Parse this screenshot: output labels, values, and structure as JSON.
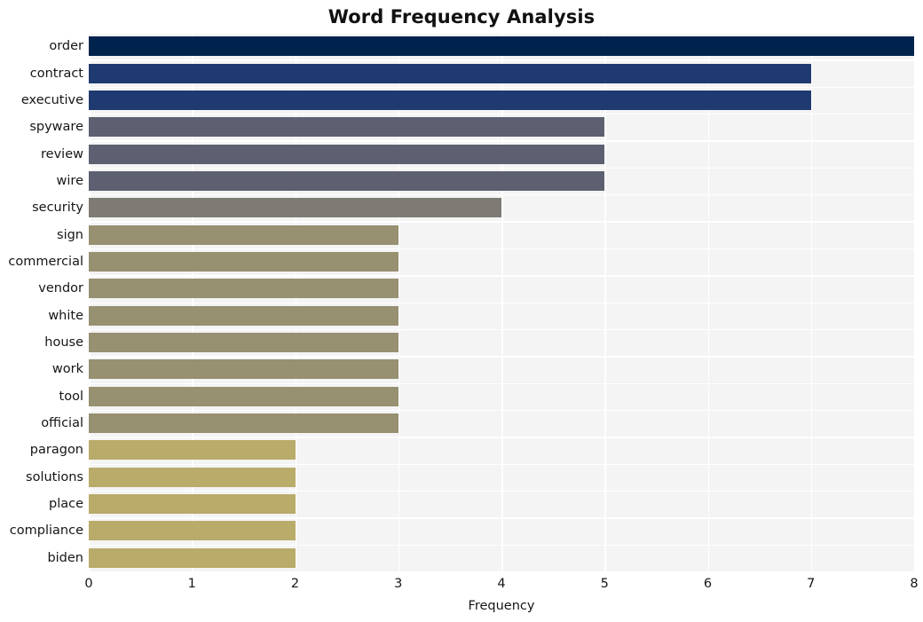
{
  "chart_data": {
    "type": "bar",
    "orientation": "horizontal",
    "title": "Word Frequency Analysis",
    "xlabel": "Frequency",
    "ylabel": "",
    "categories": [
      "order",
      "contract",
      "executive",
      "spyware",
      "review",
      "wire",
      "security",
      "sign",
      "commercial",
      "vendor",
      "white",
      "house",
      "work",
      "tool",
      "official",
      "paragon",
      "solutions",
      "place",
      "compliance",
      "biden"
    ],
    "values": [
      8,
      7,
      7,
      5,
      5,
      5,
      4,
      3,
      3,
      3,
      3,
      3,
      3,
      3,
      3,
      2,
      2,
      2,
      2,
      2
    ],
    "bar_colors": [
      "#00234d",
      "#1f3a70",
      "#1f3a70",
      "#5c6070",
      "#5c6070",
      "#5c6070",
      "#7d7b74",
      "#979071",
      "#979071",
      "#979071",
      "#979071",
      "#979071",
      "#979071",
      "#979071",
      "#979071",
      "#b9ab69",
      "#b9ab69",
      "#b9ab69",
      "#b9ab69",
      "#b9ab69"
    ],
    "xlim": [
      0,
      8
    ],
    "xticks": [
      0,
      1,
      2,
      3,
      4,
      5,
      6,
      7,
      8
    ],
    "xtick_labels": [
      "0",
      "1",
      "2",
      "3",
      "4",
      "5",
      "6",
      "7",
      "8"
    ],
    "grid": true,
    "grid_color": "#ffffff",
    "plot_background": "#f4f4f5",
    "figure_background": "#ffffff",
    "legend": null,
    "legend_position": "none"
  }
}
